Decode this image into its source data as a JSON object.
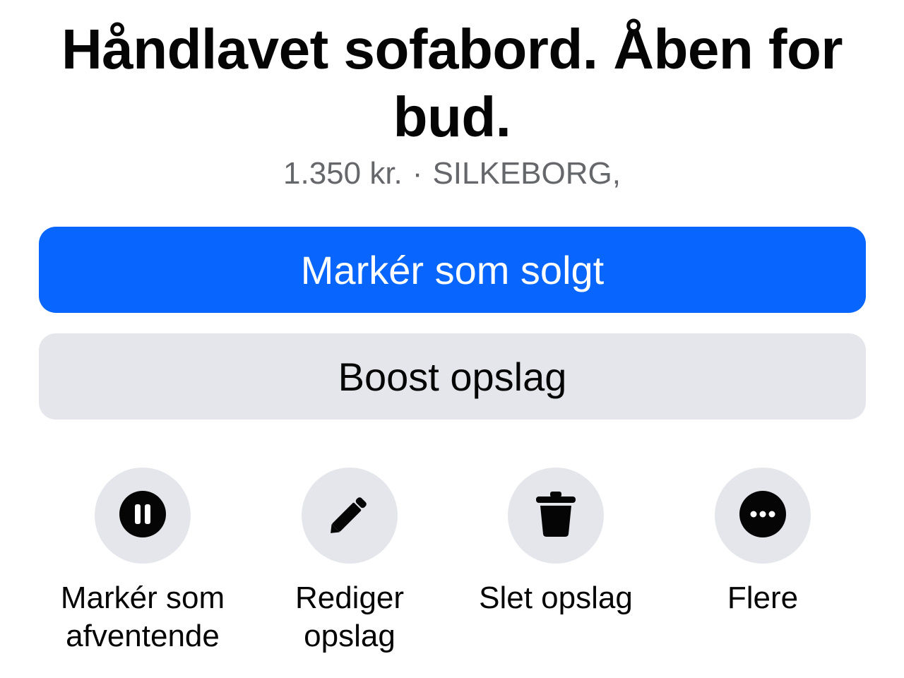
{
  "listing": {
    "title": "Håndlavet sofabord. Åben for bud.",
    "price": "1.350 kr.",
    "separator": "·",
    "location": "SILKEBORG,"
  },
  "buttons": {
    "primary_label": "Markér som solgt",
    "secondary_label": "Boost opslag"
  },
  "actions": [
    {
      "icon": "pause-icon",
      "label_line1": "Markér som",
      "label_line2": "afventende"
    },
    {
      "icon": "pencil-icon",
      "label_line1": "Rediger",
      "label_line2": "opslag"
    },
    {
      "icon": "trash-icon",
      "label_line1": "Slet opslag",
      "label_line2": ""
    },
    {
      "icon": "more-icon",
      "label_line1": "Flere",
      "label_line2": ""
    }
  ],
  "colors": {
    "primary": "#0866ff",
    "secondary_bg": "#e4e6eb",
    "meta_text": "#65676b"
  }
}
